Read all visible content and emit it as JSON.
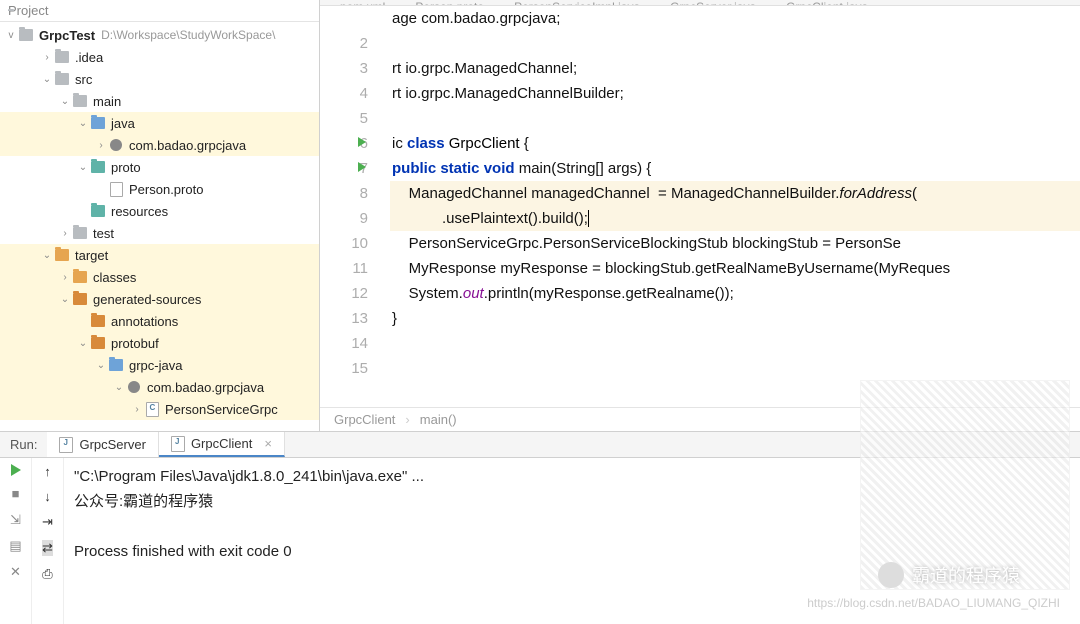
{
  "sidebar": {
    "header": "Project",
    "root": {
      "name": "GrpcTest",
      "path": "D:\\Workspace\\StudyWorkSpace\\"
    },
    "nodes": [
      {
        "label": ".idea",
        "indent": 2,
        "icon": "fold",
        "arrow": ">"
      },
      {
        "label": "src",
        "indent": 2,
        "icon": "fold",
        "arrow": "v"
      },
      {
        "label": "main",
        "indent": 3,
        "icon": "fold",
        "arrow": "v"
      },
      {
        "label": "java",
        "indent": 4,
        "icon": "fold blue",
        "arrow": "v",
        "hl": true
      },
      {
        "label": "com.badao.grpcjava",
        "indent": 5,
        "icon": "pkg",
        "arrow": ">",
        "hl": true
      },
      {
        "label": "proto",
        "indent": 4,
        "icon": "fold teal",
        "arrow": "v"
      },
      {
        "label": "Person.proto",
        "indent": 5,
        "icon": "file",
        "arrow": ""
      },
      {
        "label": "resources",
        "indent": 4,
        "icon": "fold teal",
        "arrow": ""
      },
      {
        "label": "test",
        "indent": 3,
        "icon": "fold",
        "arrow": ">"
      },
      {
        "label": "target",
        "indent": 2,
        "icon": "fold orange",
        "arrow": "v",
        "hl": true
      },
      {
        "label": "classes",
        "indent": 3,
        "icon": "fold orange",
        "arrow": ">",
        "hl": true
      },
      {
        "label": "generated-sources",
        "indent": 3,
        "icon": "fold dkorange",
        "arrow": "v",
        "hl": true
      },
      {
        "label": "annotations",
        "indent": 4,
        "icon": "fold dkorange",
        "arrow": "",
        "hl": true
      },
      {
        "label": "protobuf",
        "indent": 4,
        "icon": "fold dkorange",
        "arrow": "v",
        "hl": true
      },
      {
        "label": "grpc-java",
        "indent": 5,
        "icon": "fold blue",
        "arrow": "v",
        "hl": true
      },
      {
        "label": "com.badao.grpcjava",
        "indent": 6,
        "icon": "pkg",
        "arrow": "v",
        "hl": true
      },
      {
        "label": "PersonServiceGrpc",
        "indent": 7,
        "icon": "filec",
        "arrow": ">",
        "hl": true
      }
    ]
  },
  "tabs": [
    "pom.xml",
    "Person.proto",
    "PersonServiceImpl.java",
    "GrpcServer.java",
    "GrpcClient.java"
  ],
  "code": {
    "lines": [
      {
        "n": "",
        "html": "age com.badao.grpcjava;",
        "cls": ""
      },
      {
        "n": "2",
        "html": ""
      },
      {
        "n": "3",
        "html": "rt io.grpc.ManagedChannel;"
      },
      {
        "n": "4",
        "html": "rt io.grpc.ManagedChannelBuilder;"
      },
      {
        "n": "5",
        "html": ""
      },
      {
        "n": "6",
        "html": "ic class GrpcClient {",
        "run": true
      },
      {
        "n": "7",
        "html": "public static void main(String[] args) {",
        "run": true
      },
      {
        "n": "8",
        "html": "    ManagedChannel managedChannel  = ManagedChannelBuilder.forAddress( ",
        "sel": true
      },
      {
        "n": "9",
        "html": "            .usePlaintext().build();",
        "sel": true,
        "caret": true
      },
      {
        "n": "10",
        "html": "    PersonServiceGrpc.PersonServiceBlockingStub blockingStub = PersonSe"
      },
      {
        "n": "11",
        "html": "    MyResponse myResponse = blockingStub.getRealNameByUsername(MyReques"
      },
      {
        "n": "12",
        "html": "    System.out.println(myResponse.getRealname());"
      },
      {
        "n": "13",
        "html": "}"
      },
      {
        "n": "14",
        "html": ""
      },
      {
        "n": "15",
        "html": ""
      }
    ]
  },
  "breadcrumb": {
    "a": "GrpcClient",
    "b": "main()"
  },
  "run": {
    "label": "Run:",
    "tabs": [
      {
        "name": "GrpcServer",
        "active": false
      },
      {
        "name": "GrpcClient",
        "active": true
      }
    ],
    "console": [
      "\"C:\\Program Files\\Java\\jdk1.8.0_241\\bin\\java.exe\" ...",
      "公众号:霸道的程序猿",
      "",
      "Process finished with exit code 0"
    ]
  },
  "watermark": {
    "name": "霸道的程序猿",
    "url": "https://blog.csdn.net/BADAO_LIUMANG_QIZHI"
  }
}
